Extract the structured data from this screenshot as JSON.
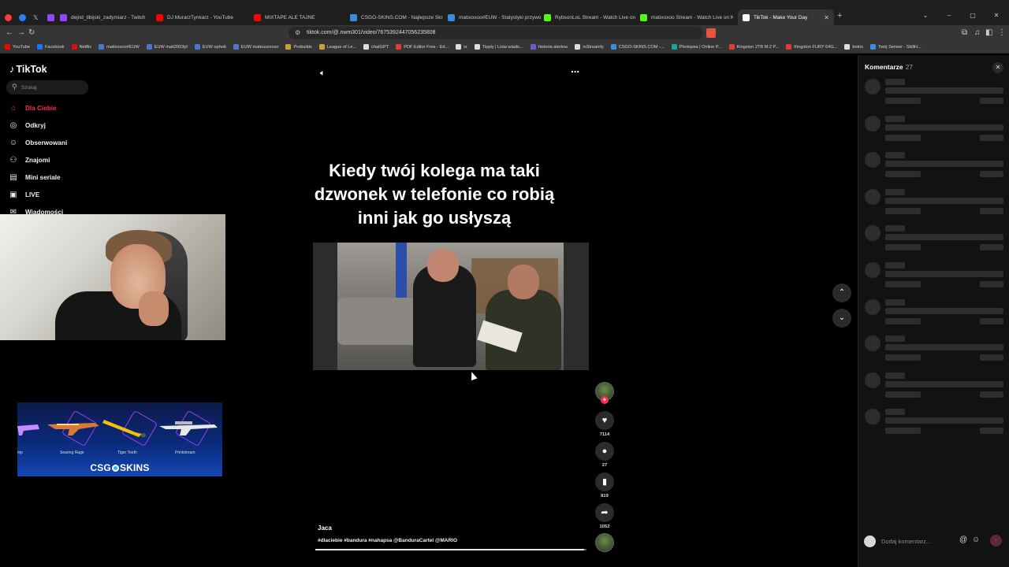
{
  "browser": {
    "tabs": [
      {
        "title": "dejnd_tibijski_zadymiarz - Twitch",
        "color": "#9146ff"
      },
      {
        "title": "DJ MurarzTynkarz - YouTube",
        "color": "#ff0000"
      },
      {
        "title": "MIXTAPE ALE TAJNE",
        "color": "#ff0000"
      },
      {
        "title": "CSGO-SKINS.COM - Najlepsze Skrzy",
        "color": "#3a8dde"
      },
      {
        "title": "matixoxoo#EUW - Statystyki przywo",
        "color": "#3a8dde"
      },
      {
        "title": "RybsonLoL Stream - Watch Live on K",
        "color": "#53fc18"
      },
      {
        "title": "matixoxoo Stream - Watch Live on K",
        "color": "#53fc18"
      },
      {
        "title": "TikTok - Make Your Day",
        "color": "#ffffff"
      }
    ],
    "url": "tiktok.com/@.nwm301/video/7675392447056235808",
    "bookmarks": [
      {
        "label": "YouTube",
        "color": "#ff0000"
      },
      {
        "label": "Facebook",
        "color": "#1877f2"
      },
      {
        "label": "Netflix",
        "color": "#e50914"
      },
      {
        "label": "matixoxoo#EUW",
        "color": "#4a76d1"
      },
      {
        "label": "EUW mati2003pl",
        "color": "#4a76d1"
      },
      {
        "label": "EUW ophob",
        "color": "#4a76d1"
      },
      {
        "label": "EUW mateuszxoxo",
        "color": "#4a76d1"
      },
      {
        "label": "Probuilds",
        "color": "#c9a13b"
      },
      {
        "label": "League of Le...",
        "color": "#c9a13b"
      },
      {
        "label": "chatGPT",
        "color": "#dddddd"
      },
      {
        "label": "PDF Editor Free - Ed...",
        "color": "#e03a3a"
      },
      {
        "label": "sr",
        "color": "#dddddd"
      },
      {
        "label": "Tipply | Lista wiado...",
        "color": "#dddddd"
      },
      {
        "label": "historia alertow",
        "color": "#6a5acd"
      },
      {
        "label": "inStreamly",
        "color": "#dddddd"
      },
      {
        "label": "CSGO-SKINS.COM -...",
        "color": "#3a8dde"
      },
      {
        "label": "Photopea | Online P...",
        "color": "#18a497"
      },
      {
        "label": "Kingston 2TB M.2 P...",
        "color": "#e03a3a"
      },
      {
        "label": "Kingston FURY 64G...",
        "color": "#e03a3a"
      },
      {
        "label": "botrix",
        "color": "#dddddd"
      },
      {
        "label": "Twój Serwer - SkillH...",
        "color": "#3a8dde"
      }
    ]
  },
  "tiktok": {
    "logo": "TikTok",
    "search_placeholder": "Szukaj",
    "nav": [
      {
        "label": "Dla Ciebie",
        "icon": "home-icon",
        "glyph": "⌂"
      },
      {
        "label": "Odkryj",
        "icon": "compass-icon",
        "glyph": "◎"
      },
      {
        "label": "Obserwowani",
        "icon": "following-icon",
        "glyph": "☺"
      },
      {
        "label": "Znajomi",
        "icon": "friends-icon",
        "glyph": "⚇"
      },
      {
        "label": "Mini seriale",
        "icon": "series-icon",
        "glyph": "▤"
      },
      {
        "label": "LIVE",
        "icon": "live-icon",
        "glyph": "▣"
      },
      {
        "label": "Wiadomości",
        "icon": "messages-icon",
        "glyph": "✉"
      }
    ],
    "accent": "#fe2c55"
  },
  "ad": {
    "skins": [
      "mp",
      "Searing Rage",
      "Tiger Tooth",
      "Printstream"
    ],
    "brand_left": "CSG",
    "brand_right": "SKINS"
  },
  "video": {
    "caption": "Kiedy twój kolega ma taki dzwonek w telefonie co robią inni jak go usłyszą",
    "author": "Jaca",
    "tags": "#dlaciebie #bandura #nahapsa @BanduraCartel @MARIO",
    "progress": 0.99,
    "likes": "7114",
    "comments": "27",
    "saves": "819",
    "shares": "1052"
  },
  "comments_panel": {
    "title": "Komentarze",
    "count": "27",
    "input_placeholder": "Dodaj komentarz...",
    "skeleton_rows": 10
  }
}
